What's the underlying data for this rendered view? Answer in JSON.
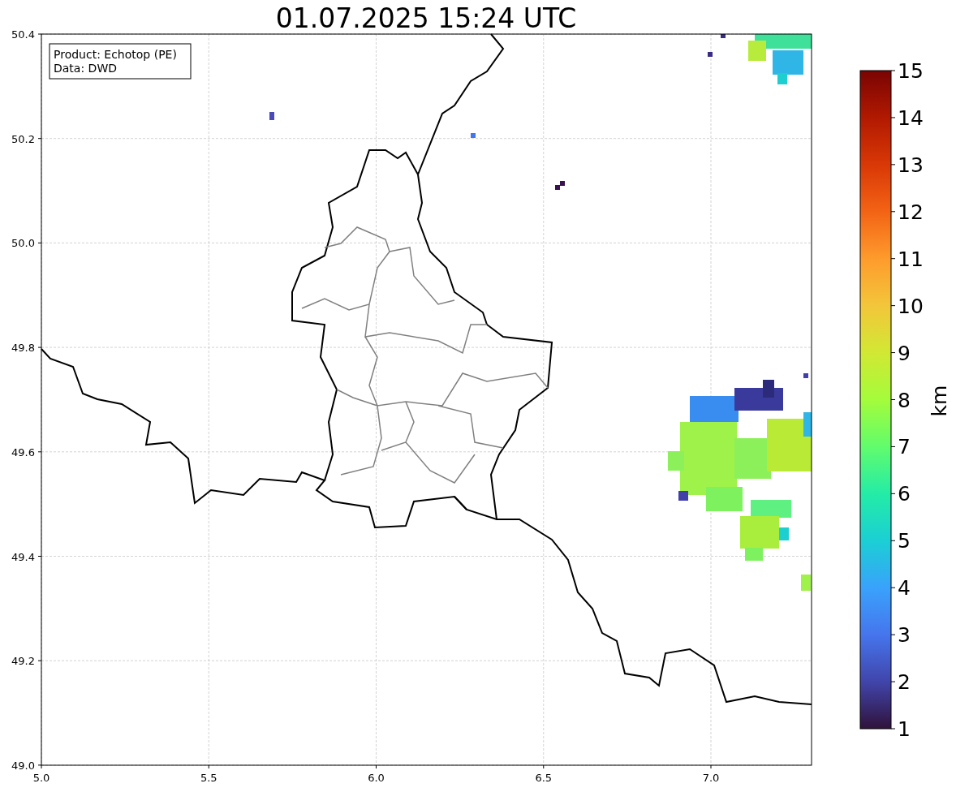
{
  "title": "01.07.2025 15:24 UTC",
  "info_box": [
    "Product: Echotop (PE)",
    "Data: DWD"
  ],
  "x_ticks": [
    "5.0",
    "5.5",
    "6.0",
    "6.5",
    "7.0"
  ],
  "y_ticks": [
    "50.4",
    "50.2",
    "50.0",
    "49.8",
    "49.6",
    "49.4",
    "49.2",
    "49.0"
  ],
  "colorbar": {
    "label": "km",
    "ticks": [
      "15",
      "14",
      "13",
      "12",
      "11",
      "10",
      "9",
      "8",
      "7",
      "6",
      "5",
      "4",
      "3",
      "2",
      "1"
    ]
  }
}
